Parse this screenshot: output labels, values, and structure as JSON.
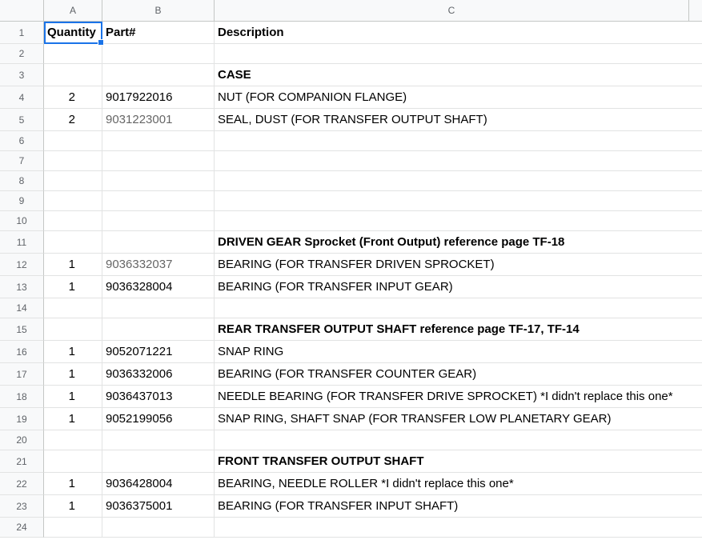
{
  "columns": [
    "A",
    "B",
    "C"
  ],
  "rows": [
    {
      "n": "1",
      "a": "Quantity",
      "b": "Part#",
      "c": "Description",
      "type": "header"
    },
    {
      "n": "2",
      "a": "",
      "b": "",
      "c": "",
      "type": "blank"
    },
    {
      "n": "3",
      "a": "",
      "b": "",
      "c": "CASE",
      "type": "section"
    },
    {
      "n": "4",
      "a": "2",
      "b": "9017922016",
      "c": "NUT (FOR COMPANION FLANGE)",
      "type": "item"
    },
    {
      "n": "5",
      "a": "2",
      "b": "9031223001",
      "c": "SEAL, DUST (FOR TRANSFER OUTPUT SHAFT)",
      "type": "item",
      "partGrey": true
    },
    {
      "n": "6",
      "a": "",
      "b": "",
      "c": "",
      "type": "blank"
    },
    {
      "n": "7",
      "a": "",
      "b": "",
      "c": "",
      "type": "blank"
    },
    {
      "n": "8",
      "a": "",
      "b": "",
      "c": "",
      "type": "blank"
    },
    {
      "n": "9",
      "a": "",
      "b": "",
      "c": "",
      "type": "blank"
    },
    {
      "n": "10",
      "a": "",
      "b": "",
      "c": "",
      "type": "blank"
    },
    {
      "n": "11",
      "a": "",
      "b": "",
      "c": "DRIVEN GEAR Sprocket (Front Output) reference page TF-18",
      "type": "section"
    },
    {
      "n": "12",
      "a": "1",
      "b": "9036332037",
      "c": "BEARING (FOR TRANSFER DRIVEN SPROCKET)",
      "type": "item",
      "partGrey": true
    },
    {
      "n": "13",
      "a": "1",
      "b": "9036328004",
      "c": "BEARING (FOR TRANSFER INPUT GEAR)",
      "type": "item"
    },
    {
      "n": "14",
      "a": "",
      "b": "",
      "c": "",
      "type": "blank"
    },
    {
      "n": "15",
      "a": "",
      "b": "",
      "c": "REAR TRANSFER OUTPUT SHAFT reference page TF-17, TF-14",
      "type": "section"
    },
    {
      "n": "16",
      "a": "1",
      "b": "9052071221",
      "c": "SNAP RING",
      "type": "item"
    },
    {
      "n": "17",
      "a": "1",
      "b": "9036332006",
      "c": "BEARING (FOR TRANSFER COUNTER GEAR)",
      "type": "item"
    },
    {
      "n": "18",
      "a": "1",
      "b": "9036437013",
      "c": "NEEDLE BEARING (FOR TRANSFER DRIVE SPROCKET) *I didn't replace this one*",
      "type": "item"
    },
    {
      "n": "19",
      "a": "1",
      "b": "9052199056",
      "c": "SNAP RING, SHAFT SNAP (FOR TRANSFER LOW PLANETARY GEAR)",
      "type": "item"
    },
    {
      "n": "20",
      "a": "",
      "b": "",
      "c": "",
      "type": "blank"
    },
    {
      "n": "21",
      "a": "",
      "b": "",
      "c": "FRONT TRANSFER OUTPUT SHAFT",
      "type": "section"
    },
    {
      "n": "22",
      "a": "1",
      "b": "9036428004",
      "c": "BEARING, NEEDLE ROLLER *I didn't replace this one*",
      "type": "item"
    },
    {
      "n": "23",
      "a": "1",
      "b": "9036375001",
      "c": "BEARING (FOR TRANSFER INPUT SHAFT)",
      "type": "item"
    },
    {
      "n": "24",
      "a": "",
      "b": "",
      "c": "",
      "type": "blank"
    }
  ],
  "colors": {
    "selection": "#1a73e8",
    "grid": "#e2e3e3",
    "header_bg": "#f8f9fa"
  }
}
